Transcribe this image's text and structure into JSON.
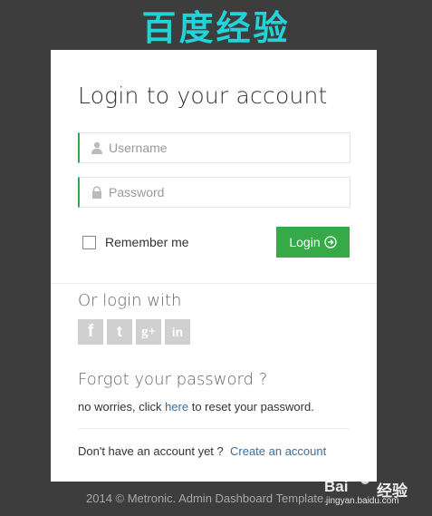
{
  "banner": {
    "text": "百度经验"
  },
  "login": {
    "title": "Login to your account",
    "username_placeholder": "Username",
    "password_placeholder": "Password",
    "remember_label": "Remember me",
    "login_button": "Login",
    "icons": {
      "username": "user-icon",
      "password": "lock-icon",
      "login": "arrow-circle-right-icon"
    },
    "accent_color": "#35aa47"
  },
  "social": {
    "heading": "Or login with",
    "buttons": [
      {
        "name": "facebook-button",
        "glyph": "f"
      },
      {
        "name": "twitter-button",
        "glyph": "t"
      },
      {
        "name": "google-plus-button",
        "glyph": "g+"
      },
      {
        "name": "linkedin-button",
        "glyph": "in"
      }
    ]
  },
  "forgot": {
    "heading": "Forgot your password ?",
    "text_before": "no worries, click ",
    "link": "here",
    "text_after": " to reset your password."
  },
  "signup": {
    "text": "Don't have an account yet ?",
    "link": "Create an account"
  },
  "footer": {
    "copyright": "2014 © Metronic. Admin Dashboard Template."
  },
  "watermark": {
    "brand": "Bai",
    "brand2": "经验",
    "url": "jingyan.baidu.com"
  }
}
